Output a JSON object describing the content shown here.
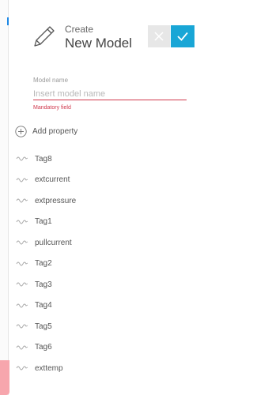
{
  "header": {
    "title_small": "Create",
    "title_large": "New Model"
  },
  "form": {
    "label": "Model name",
    "placeholder": "Insert model name",
    "value": "",
    "error": "Mandatory field"
  },
  "add_property": {
    "label": "Add property"
  },
  "tags": [
    {
      "label": "Tag8"
    },
    {
      "label": "extcurrent"
    },
    {
      "label": "extpressure"
    },
    {
      "label": "Tag1"
    },
    {
      "label": "pullcurrent"
    },
    {
      "label": "Tag2"
    },
    {
      "label": "Tag3"
    },
    {
      "label": "Tag4"
    },
    {
      "label": "Tag5"
    },
    {
      "label": "Tag6"
    },
    {
      "label": "exttemp"
    }
  ],
  "colors": {
    "accent": "#19a6d6",
    "error": "#d0394d"
  }
}
